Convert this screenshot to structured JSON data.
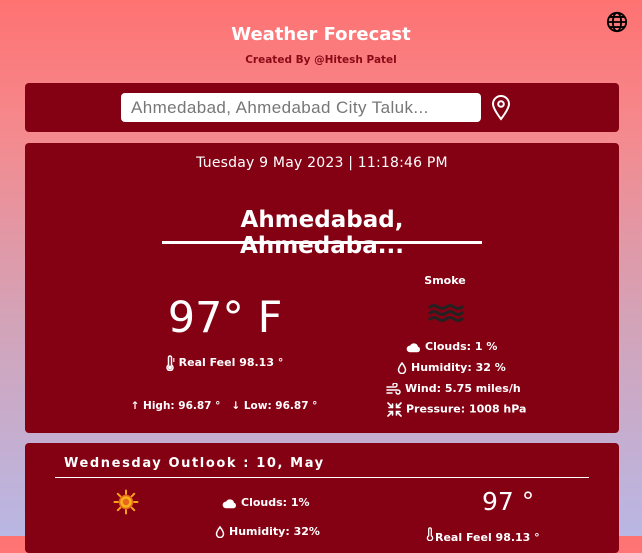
{
  "header": {
    "title": "Weather Forecast",
    "subtitle": "Created By @Hitesh Patel",
    "language_icon": "globe-icon"
  },
  "search": {
    "value": "Ahmedabad, Ahmedabad City Taluk...",
    "location_icon": "map-pin-icon"
  },
  "current": {
    "datetime": "Tuesday 9 May 2023 | 11:18:46 PM",
    "city": "Ahmedabad, Ahmedaba...",
    "temperature": "97° F",
    "real_feel": "Real Feel 98.13 °",
    "high": "High: 96.87 °",
    "low": "Low: 96.87 °",
    "condition": "Smoke",
    "condition_icon": "smoke-icon",
    "clouds": "Clouds: 1 %",
    "humidity": "Humidity: 32 %",
    "wind": "Wind: 5.75 miles/h",
    "pressure": "Pressure: 1008 hPa"
  },
  "outlook": {
    "title": "Wednesday Outlook : 10, May",
    "icon": "sun-icon",
    "clouds": "Clouds: 1%",
    "humidity": "Humidity: 32%",
    "temperature": "97 °",
    "real_feel": "Real Feel 98.13 °"
  },
  "colors": {
    "panel": "#840113",
    "subtitle": "#8b0a17",
    "gradient_top": "#ff7272",
    "gradient_bottom": "#b9b7e4"
  }
}
